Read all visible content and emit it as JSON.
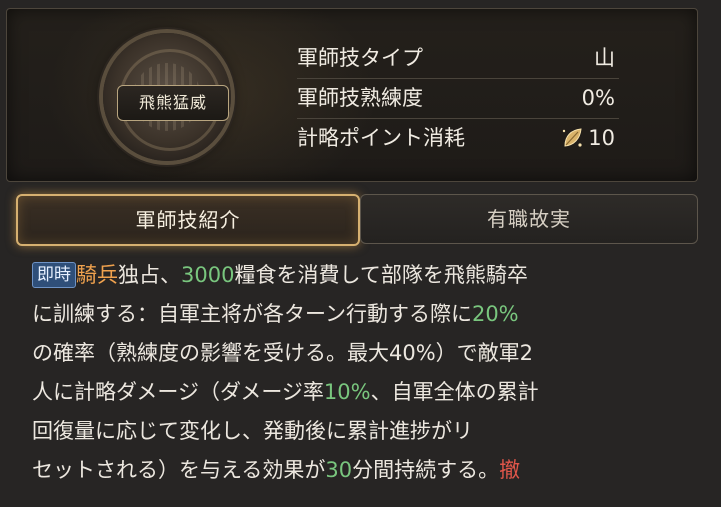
{
  "header": {
    "tactic_name": "飛熊猛威",
    "stats": [
      {
        "label": "軍師技タイプ",
        "value": "山"
      },
      {
        "label": "軍師技熟練度",
        "value": "0%"
      },
      {
        "label": "計略ポイント消耗",
        "value": "10",
        "icon": "leaf-icon"
      }
    ]
  },
  "tabs": {
    "active": "軍師技紹介",
    "inactive": "有職故実"
  },
  "description": {
    "badge": "即時",
    "lines": [
      {
        "segments": [
          {
            "t": "騎兵",
            "c": "orange"
          },
          {
            "t": "独占、",
            "c": ""
          },
          {
            "t": "3000",
            "c": "green"
          },
          {
            "t": "糧食を消費して部隊を飛熊騎卒",
            "c": ""
          }
        ]
      },
      {
        "segments": [
          {
            "t": "に訓練する：自軍主将が各ターン行動する際に",
            "c": ""
          },
          {
            "t": "20%",
            "c": "green"
          }
        ]
      },
      {
        "segments": [
          {
            "t": "の確率（熟練度の影響を受ける。最大40%）で敵軍2",
            "c": ""
          }
        ]
      },
      {
        "segments": [
          {
            "t": "人に計略ダメージ（ダメージ率",
            "c": ""
          },
          {
            "t": "10%",
            "c": "green"
          },
          {
            "t": "、自軍全体の累計",
            "c": ""
          }
        ]
      },
      {
        "segments": [
          {
            "t": "回復量に応じて変化し、発動後に累計進捗がリ",
            "c": ""
          }
        ]
      },
      {
        "segments": [
          {
            "t": "セットされる）を与える効果が",
            "c": ""
          },
          {
            "t": "30",
            "c": "green"
          },
          {
            "t": "分間持続する。",
            "c": ""
          },
          {
            "t": "撤",
            "c": "red"
          }
        ]
      }
    ]
  },
  "colors": {
    "accent_gold": "#d6b070",
    "highlight_orange": "#f0a24e",
    "highlight_green": "#79c67e",
    "highlight_red": "#e0564a",
    "badge_blue": "#2f4f79"
  }
}
